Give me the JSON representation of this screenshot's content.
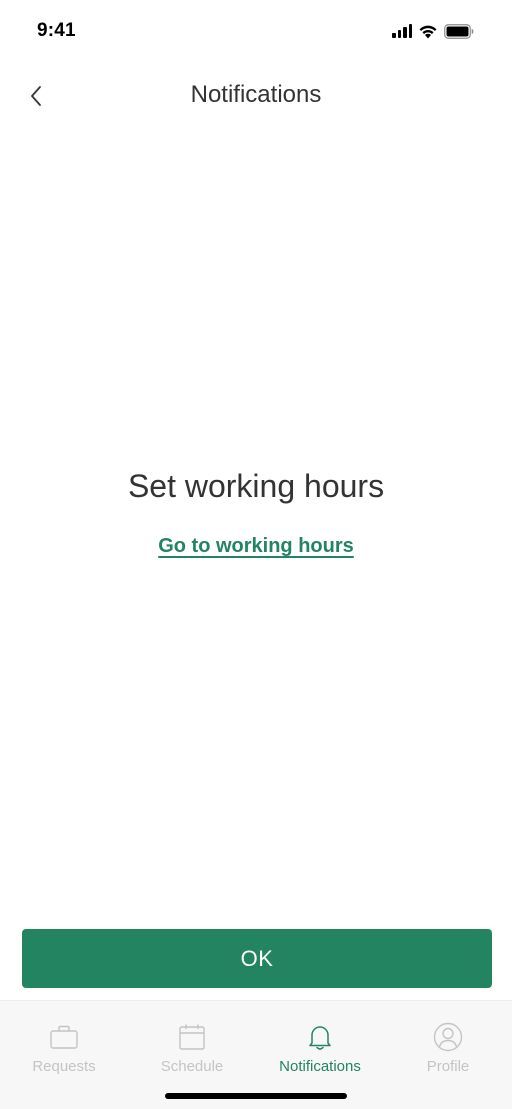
{
  "status_bar": {
    "time": "9:41"
  },
  "nav": {
    "title": "Notifications",
    "back_icon": "chevron-left-icon"
  },
  "empty_state": {
    "title": "Set working hours",
    "link_label": "Go to working hours"
  },
  "ok_button": {
    "label": "OK"
  },
  "tab_bar": {
    "tabs": [
      {
        "label": "Requests",
        "icon": "briefcase-icon",
        "active": false
      },
      {
        "label": "Schedule",
        "icon": "calendar-icon",
        "active": false
      },
      {
        "label": "Notifications",
        "icon": "bell-icon",
        "active": true
      },
      {
        "label": "Profile",
        "icon": "user-icon",
        "active": false
      }
    ]
  },
  "colors": {
    "accent": "#238461",
    "text": "#333333",
    "inactive_tab": "#c4c4c4",
    "tab_bar_bg": "#f7f7f7"
  }
}
